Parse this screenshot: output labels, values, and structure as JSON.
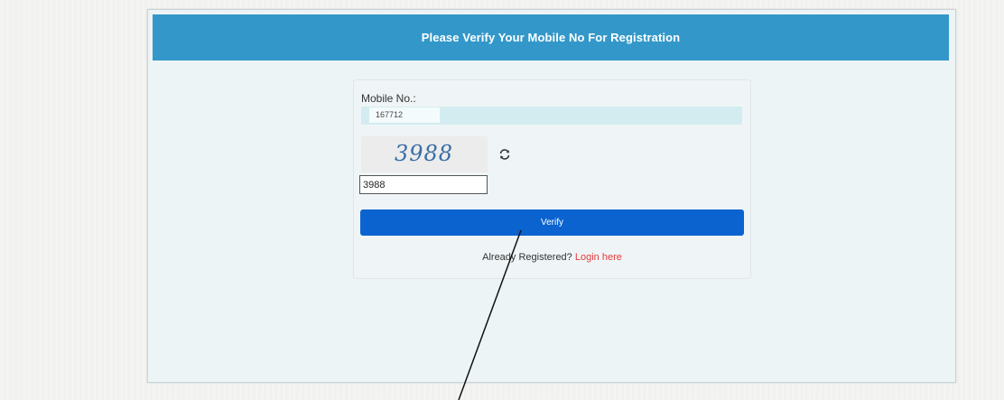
{
  "panel": {
    "title": "Please Verify Your Mobile No For Registration"
  },
  "form": {
    "mobile_label": "Mobile No.:",
    "mobile_value": "167712",
    "captcha_image_text": "3988",
    "captcha_input_value": "3988",
    "refresh_icon": "refresh-icon",
    "verify_label": "Verify",
    "already_registered_text": "Already Registered?",
    "login_link_text": "Login here"
  },
  "colors": {
    "header": "#3398c9",
    "verify_button": "#0b63cf",
    "login_link": "#e43b3b"
  }
}
